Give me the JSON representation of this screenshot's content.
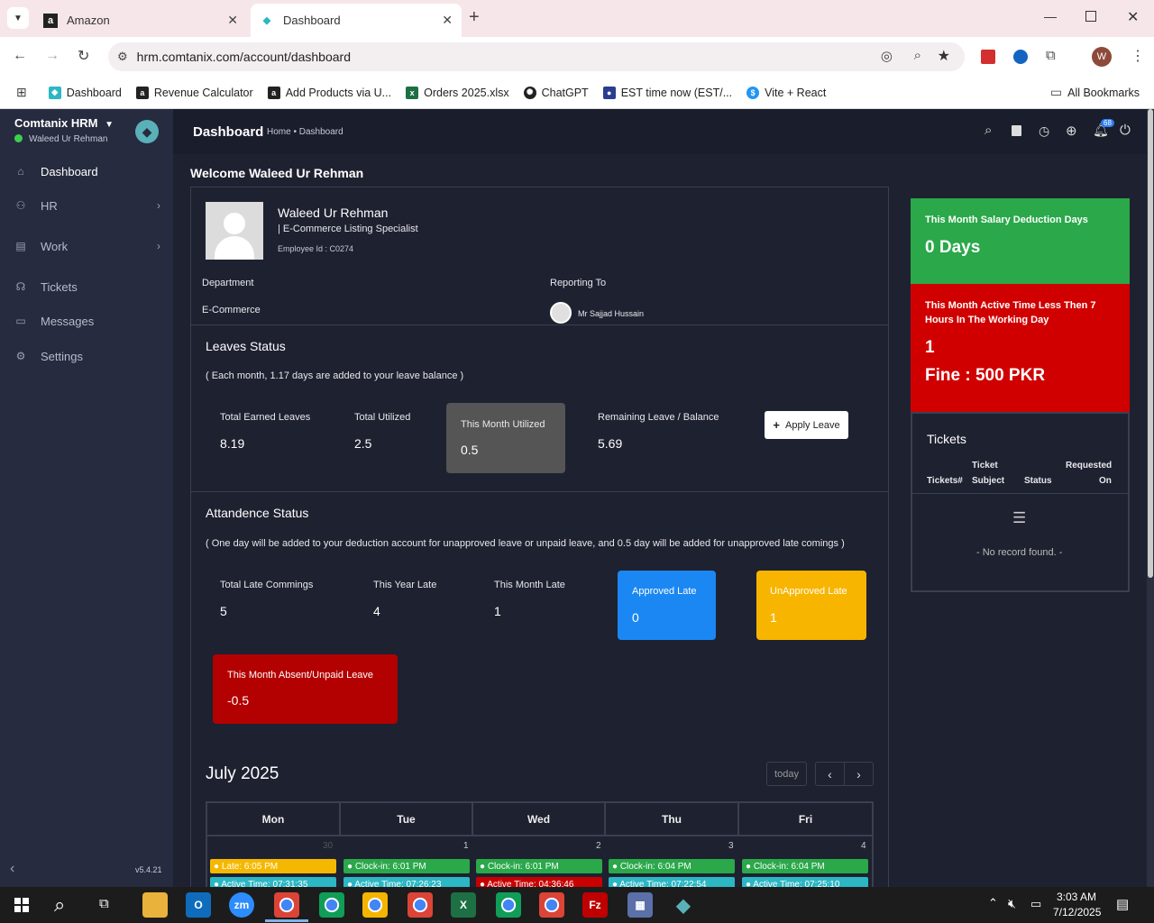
{
  "browser": {
    "tabs": [
      {
        "label": "Amazon",
        "icon": "amazon-icon"
      },
      {
        "label": "Dashboard",
        "icon": "comtanix-icon"
      }
    ],
    "url": "hrm.comtanix.com/account/dashboard",
    "profile_initial": "W",
    "bookmarks": [
      {
        "label": "Dashboard",
        "color": "#2bb7c4"
      },
      {
        "label": "Revenue Calculator",
        "color": "#222"
      },
      {
        "label": "Add Products via U...",
        "color": "#222"
      },
      {
        "label": "Orders 2025.xlsx",
        "color": "#1d7044"
      },
      {
        "label": "ChatGPT",
        "color": "#222"
      },
      {
        "label": "EST time now (EST/...",
        "color": "#2a3d8f"
      },
      {
        "label": "Vite + React",
        "color": "#2196f3"
      }
    ],
    "all_bookmarks": "All Bookmarks"
  },
  "sidebar": {
    "brand": "Comtanix HRM",
    "user": "Waleed Ur Rehman",
    "items": [
      {
        "label": "Dashboard",
        "icon": "home-icon"
      },
      {
        "label": "HR",
        "icon": "users-icon"
      },
      {
        "label": "Work",
        "icon": "briefcase-icon"
      },
      {
        "label": "Tickets",
        "icon": "headset-icon"
      },
      {
        "label": "Messages",
        "icon": "message-icon"
      },
      {
        "label": "Settings",
        "icon": "gear-icon"
      }
    ],
    "version": "v5.4.21"
  },
  "appbar": {
    "title": "Dashboard",
    "breadcrumb_home": "Home",
    "breadcrumb_sep": "•",
    "breadcrumb_current": "Dashboard",
    "notification_count": "68"
  },
  "main": {
    "welcome": "Welcome Waleed Ur Rehman",
    "profile": {
      "name": "Waleed Ur Rehman",
      "role": "| E-Commerce Listing Specialist",
      "employee_id": "Employee Id : C0274",
      "department_label": "Department",
      "department": "E-Commerce",
      "reporting_label": "Reporting To",
      "reporting_to": "Mr Sajjad Hussain"
    },
    "leaves": {
      "title": "Leaves Status",
      "note": "( Each month, 1.17 days are added to your leave balance )",
      "total_earned_label": "Total Earned Leaves",
      "total_earned": "8.19",
      "total_utilized_label": "Total Utilized",
      "total_utilized": "2.5",
      "month_utilized_label": "This Month Utilized",
      "month_utilized": "0.5",
      "remaining_label": "Remaining Leave / Balance",
      "remaining": "5.69",
      "apply_label": "Apply Leave"
    },
    "attendance": {
      "title": "Attandence Status",
      "note": "( One day will be added to your deduction account for unapproved leave or unpaid leave, and 0.5 day will be added for unapproved late comings )",
      "total_late_label": "Total Late Commings",
      "total_late": "5",
      "year_late_label": "This Year Late",
      "year_late": "4",
      "month_late_label": "This Month Late",
      "month_late": "1",
      "approved_label": "Approved Late",
      "approved": "0",
      "unapproved_label": "UnApproved Late",
      "unapproved": "1",
      "absent_label": "This Month Absent/Unpaid Leave",
      "absent": "-0.5"
    },
    "calendar": {
      "title": "July 2025",
      "today": "today",
      "days": [
        "Mon",
        "Tue",
        "Wed",
        "Thu",
        "Fri"
      ],
      "dates": [
        "30",
        "1",
        "2",
        "3",
        "4"
      ],
      "events_row1": [
        "Late: 6:05 PM",
        "Clock-in: 6:01 PM",
        "Clock-in: 6:01 PM",
        "Clock-in: 6:04 PM",
        "Clock-in: 6:04 PM"
      ],
      "events_row2": [
        "Active Time: 07:31:35",
        "Active Time: 07:26:23",
        "Active Time: 04:36:46",
        "Active Time: 07:22:54",
        "Active Time: 07:25:10"
      ],
      "row1_colors": [
        "#f5b800",
        "#2aa84a",
        "#2aa84a",
        "#2aa84a",
        "#2aa84a"
      ],
      "row2_colors": [
        "#2bb7c4",
        "#2bb7c4",
        "#c80000",
        "#2bb7c4",
        "#2bb7c4"
      ]
    }
  },
  "right": {
    "salary_label": "This Month Salary Deduction Days",
    "salary_value": "0 Days",
    "active_label": "This Month Active Time Less Then 7 Hours In The Working Day",
    "active_value": "1",
    "fine": "Fine : 500 PKR",
    "tickets_title": "Tickets",
    "col1": "Tickets#",
    "col2a": "Ticket",
    "col2b": "Subject",
    "col3": "Status",
    "col4a": "Requested",
    "col4b": "On",
    "empty": "- No record found. -"
  },
  "taskbar": {
    "time": "3:03 AM",
    "date": "7/12/2025"
  }
}
